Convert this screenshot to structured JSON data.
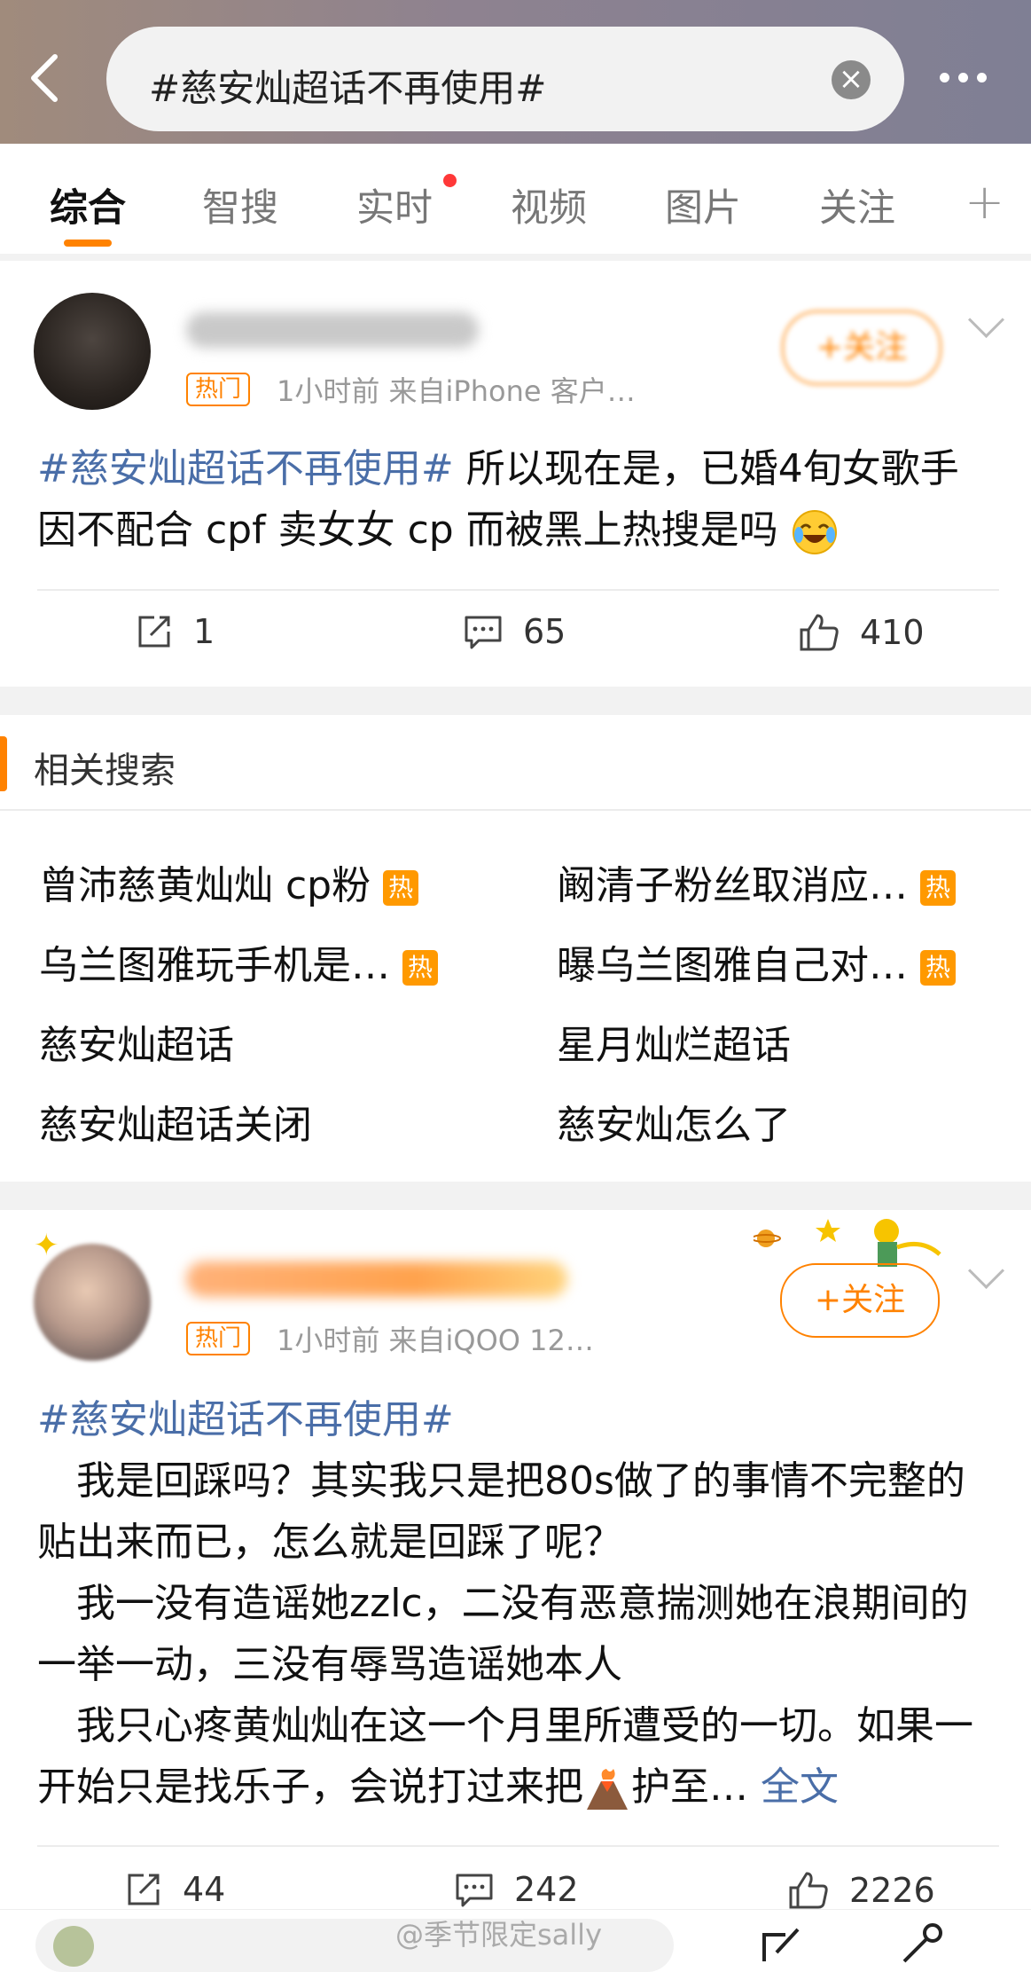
{
  "search": {
    "query": "#慈安灿超话不再使用#"
  },
  "tabs": [
    "综合",
    "智搜",
    "实时",
    "视频",
    "图片",
    "关注"
  ],
  "post1": {
    "hot_badge": "热门",
    "meta": "1小时前  来自iPhone 客户…",
    "follow_label": "+关注",
    "hashtag": "#慈安灿超话不再使用#",
    "text": " 所以现在是，已婚4旬女歌手因不配合 cpf 卖女女 cp 而被黑上热搜是吗",
    "emoji": "crying-laughing-face",
    "reposts": "1",
    "comments": "65",
    "likes": "410"
  },
  "related": {
    "title": "相关搜索",
    "hot_label": "热",
    "items": [
      {
        "text": "曾沛慈黄灿灿 cp粉",
        "hot": true
      },
      {
        "text": "阚清子粉丝取消应…",
        "hot": true
      },
      {
        "text": "乌兰图雅玩手机是…",
        "hot": true
      },
      {
        "text": "曝乌兰图雅自己对…",
        "hot": true
      },
      {
        "text": "慈安灿超话",
        "hot": false
      },
      {
        "text": "星月灿烂超话",
        "hot": false
      },
      {
        "text": "慈安灿超话关闭",
        "hot": false
      },
      {
        "text": "慈安灿怎么了",
        "hot": false
      }
    ]
  },
  "post2": {
    "hot_badge": "热门",
    "meta": "1小时前  来自iQOO 12…",
    "follow_label": "+关注",
    "hashtag": "#慈安灿超话不再使用#",
    "para1": "　我是回踩吗？其实我只是把80s做了的事情不完整的贴出来而已，怎么就是回踩了呢？",
    "para2": "　我一没有造谣她zzlc，二没有恶意揣测她在浪期间的一举一动，三没有辱骂造谣她本人",
    "para3a": "　我只心疼黄灿灿在这一个月里所遭受的一切。如果一开始只是找乐子，会说打过来把",
    "emoji": "volcano",
    "para3b": "护至…",
    "full_text_link": "全文",
    "reposts": "44",
    "comments": "242",
    "likes": "2226"
  },
  "watermark": "@季节限定sally",
  "colors": {
    "accent": "#ff8200",
    "link": "#4a6ea8",
    "hot": "#ff9900"
  }
}
